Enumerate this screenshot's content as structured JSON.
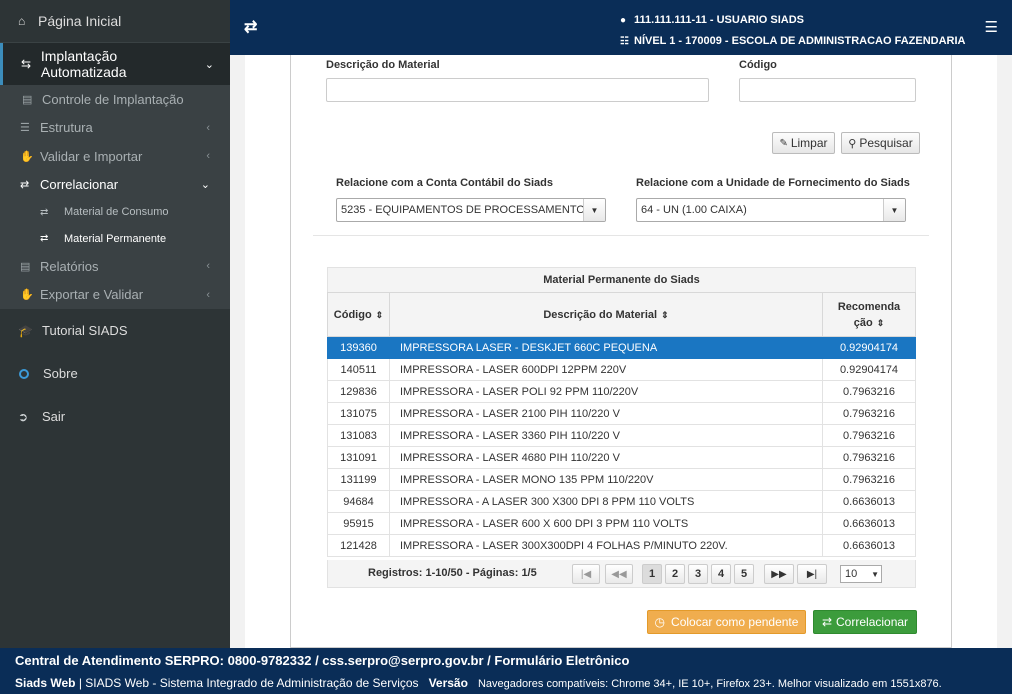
{
  "sidebar": {
    "home": "Página Inicial",
    "section": "Implantação Automatizada",
    "items": [
      {
        "label": "Controle de Implantação"
      },
      {
        "label": "Estrutura"
      },
      {
        "label": "Validar e Importar"
      },
      {
        "label": "Correlacionar"
      },
      {
        "label": "Relatórios"
      },
      {
        "label": "Exportar e Validar"
      }
    ],
    "sub": [
      "Material de Consumo",
      "Material Permanente"
    ],
    "bottom": [
      "Tutorial SIADS",
      "Sobre",
      "Sair"
    ]
  },
  "header": {
    "user": "111.111.111-11 - USUARIO SIADS",
    "level": "NÍVEL 1 - 170009 - ESCOLA DE ADMINISTRACAO FAZENDARIA"
  },
  "form": {
    "desc_label": "Descrição do Material",
    "code_label": "Código",
    "clear": "Limpar",
    "search": "Pesquisar",
    "account_label": "Relacione com a Conta Contábil do Siads",
    "account_value": "5235 - EQUIPAMENTOS DE PROCESSAMENTO",
    "unit_label": "Relacione com a Unidade de Fornecimento do Siads",
    "unit_value": "64 - UN (1.00 CAIXA)"
  },
  "table": {
    "caption": "Material Permanente do Siads",
    "col_code": "Código",
    "col_desc": "Descrição do Material",
    "col_rec_1": "Recomenda",
    "col_rec_2": "ção",
    "rows": [
      {
        "code": "139360",
        "desc": "IMPRESSORA LASER - DESKJET 660C PEQUENA",
        "rec": "0.92904174"
      },
      {
        "code": "140511",
        "desc": "IMPRESSORA - LASER 600DPI 12PPM 220V",
        "rec": "0.92904174"
      },
      {
        "code": "129836",
        "desc": "IMPRESSORA - LASER POLI 92 PPM 110/220V",
        "rec": "0.7963216"
      },
      {
        "code": "131075",
        "desc": "IMPRESSORA - LASER 2100 PIH 110/220 V",
        "rec": "0.7963216"
      },
      {
        "code": "131083",
        "desc": "IMPRESSORA - LASER 3360 PIH 110/220 V",
        "rec": "0.7963216"
      },
      {
        "code": "131091",
        "desc": "IMPRESSORA - LASER 4680 PIH 110/220 V",
        "rec": "0.7963216"
      },
      {
        "code": "131199",
        "desc": "IMPRESSORA - LASER MONO 135 PPM 110/220V",
        "rec": "0.7963216"
      },
      {
        "code": "94684",
        "desc": "IMPRESSORA - A LASER 300 X300 DPI 8 PPM 110 VOLTS",
        "rec": "0.6636013"
      },
      {
        "code": "95915",
        "desc": "IMPRESSORA - LASER 600 X 600 DPI 3 PPM 110 VOLTS",
        "rec": "0.6636013"
      },
      {
        "code": "121428",
        "desc": "IMPRESSORA - LASER 300X300DPI 4 FOLHAS P/MINUTO 220V.",
        "rec": "0.6636013"
      }
    ]
  },
  "pager": {
    "info": "Registros: 1-10/50 - Páginas: 1/5",
    "pages": [
      "1",
      "2",
      "3",
      "4",
      "5"
    ],
    "size": "10"
  },
  "actions": {
    "pending": "Colocar como pendente",
    "correlate": "Correlacionar"
  },
  "footer": {
    "line1": "Central de Atendimento SERPRO: 0800-9782332 / css.serpro@serpro.gov.br / Formulário Eletrônico",
    "brand": "Siads Web",
    "desc": "| SIADS Web - Sistema Integrado de Administração de Serviços",
    "version": "Versão",
    "browsers": "Navegadores compatíveis: Chrome 34+, IE 10+, Firefox 23+. Melhor visualizado em 1551x876."
  }
}
